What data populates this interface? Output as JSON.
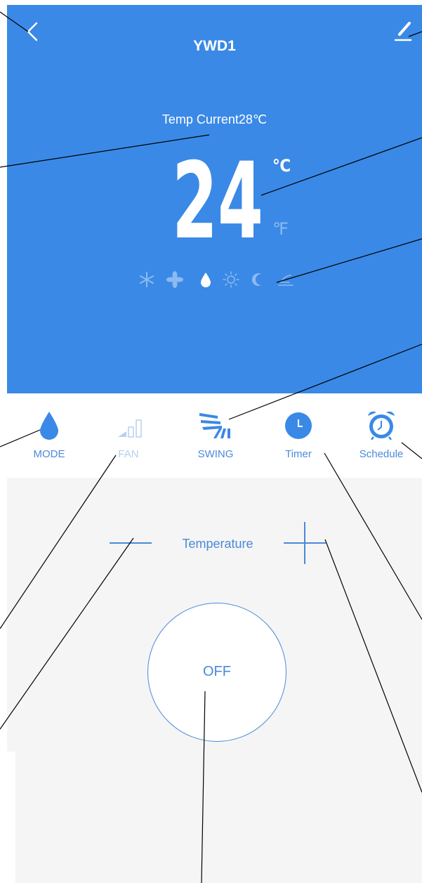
{
  "header": {
    "title": "YWD1",
    "back_icon": "chevron-left-icon",
    "edit_icon": "pencil-icon"
  },
  "status": {
    "current_temp_label": "Temp Current28℃",
    "set_temp": "24",
    "unit_celsius": "℃",
    "unit_fahrenheit": "℉",
    "active_unit": "celsius"
  },
  "modes": [
    {
      "name": "snowflake-icon",
      "active": false
    },
    {
      "name": "fan-icon",
      "active": false
    },
    {
      "name": "droplet-icon",
      "active": true
    },
    {
      "name": "sun-icon",
      "active": false
    },
    {
      "name": "moon-icon",
      "active": false
    },
    {
      "name": "eco-icon",
      "active": false
    }
  ],
  "toolbar": [
    {
      "label": "MODE",
      "icon": "droplet-icon",
      "enabled": true
    },
    {
      "label": "FAN",
      "icon": "signal-bars-icon",
      "enabled": false
    },
    {
      "label": "SWING",
      "icon": "swing-icon",
      "enabled": true
    },
    {
      "label": "Timer",
      "icon": "clock-icon",
      "enabled": true
    },
    {
      "label": "Schedule",
      "icon": "alarm-clock-icon",
      "enabled": true
    }
  ],
  "temperature_control": {
    "label": "Temperature",
    "minus_icon": "minus-icon",
    "plus_icon": "plus-icon"
  },
  "power": {
    "label": "OFF"
  },
  "colors": {
    "primary_blue": "#3a89e6",
    "accent": "#4a8ad8",
    "disabled": "#b6d0ef",
    "background_gray": "#f5f5f5"
  }
}
